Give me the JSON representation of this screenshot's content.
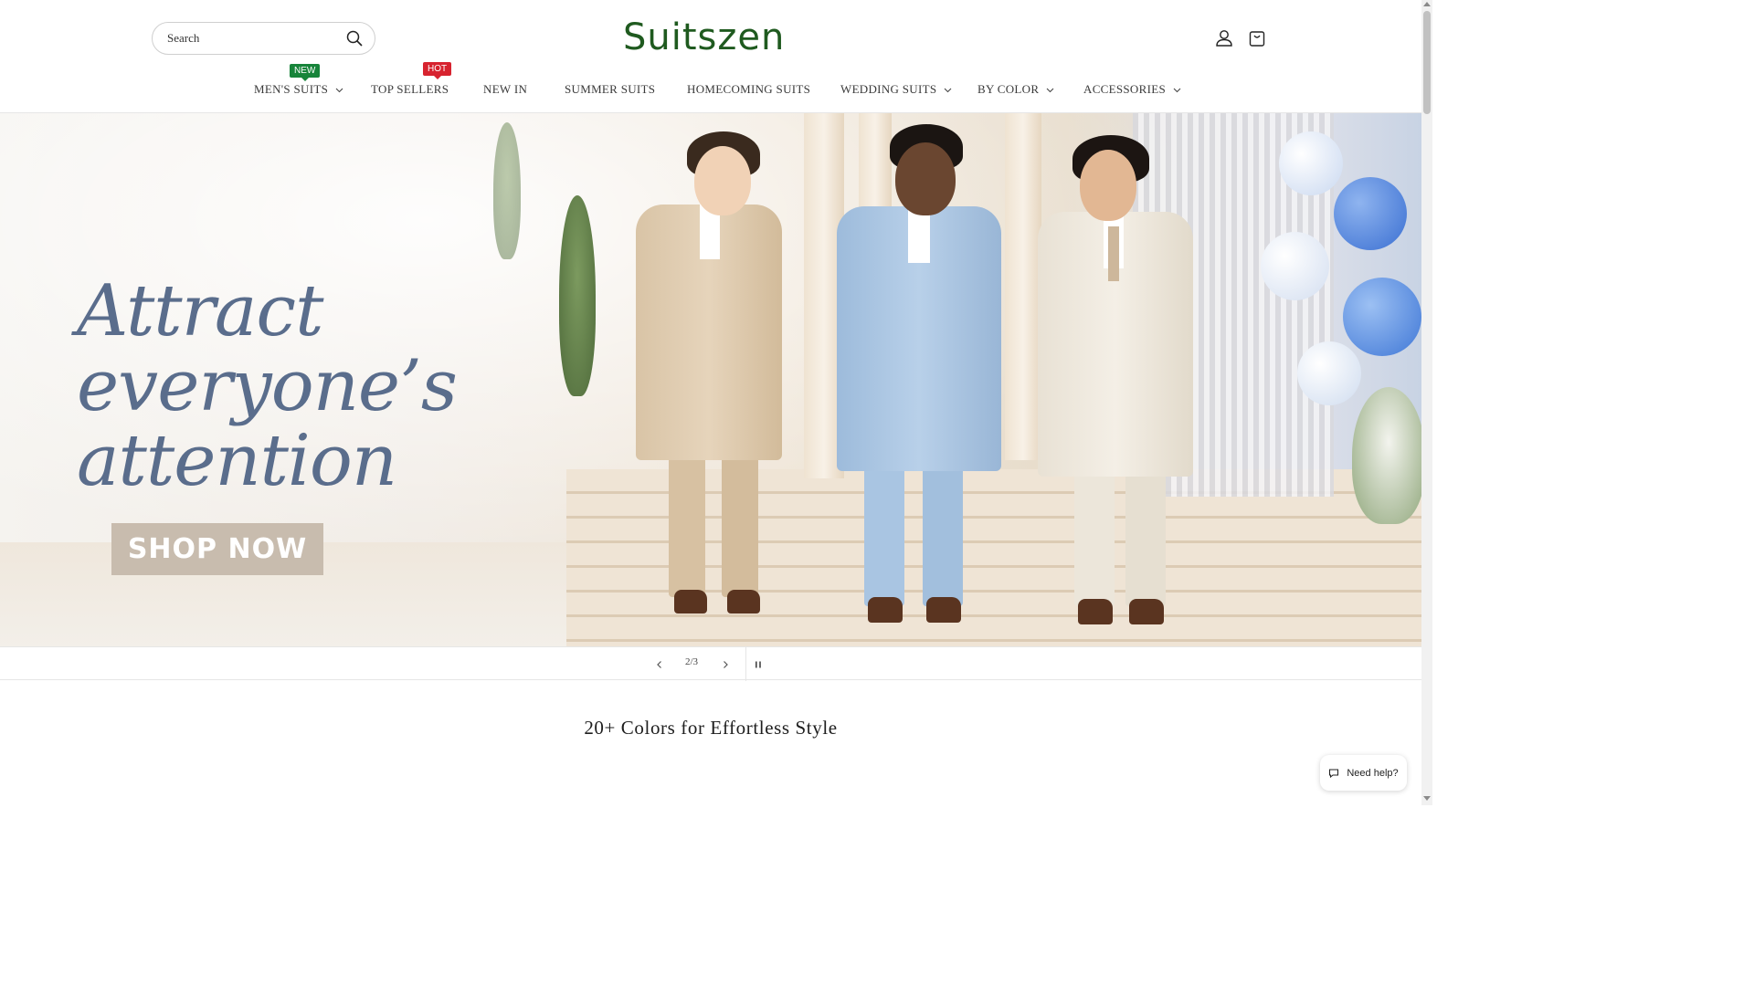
{
  "header": {
    "search_placeholder": "Search",
    "logo_text": "Suitszen",
    "brand_color": "#1f5a1f"
  },
  "nav": {
    "items": [
      {
        "label": "MEN'S SUITS",
        "badge": "NEW",
        "dropdown": true
      },
      {
        "label": "TOP SELLERS",
        "badge": "HOT",
        "dropdown": false
      },
      {
        "label": "NEW IN",
        "dropdown": false
      },
      {
        "label": "SUMMER SUITS",
        "dropdown": false
      },
      {
        "label": "HOMECOMING SUITS",
        "dropdown": false
      },
      {
        "label": "WEDDING SUITS",
        "dropdown": true
      },
      {
        "label": "BY COLOR",
        "dropdown": true
      },
      {
        "label": "ACCESSORIES",
        "dropdown": true
      }
    ],
    "badge_colors": {
      "new": "#17843a",
      "hot": "#d7232f"
    }
  },
  "hero": {
    "headline_lines": [
      "Attract",
      "everyone’s",
      "attention"
    ],
    "cta_label": "SHOP NOW",
    "headline_color": "#5a6d8c",
    "cta_color": "#c8bcae"
  },
  "slider": {
    "counter": "2/3"
  },
  "section": {
    "title": "20+ Colors for Effortless Style"
  },
  "chat": {
    "label": "Need help?"
  },
  "icons": [
    "search-icon",
    "account-icon",
    "cart-icon",
    "chevron-down-icon",
    "chevron-left-icon",
    "chevron-right-icon",
    "pause-icon",
    "chat-icon"
  ]
}
